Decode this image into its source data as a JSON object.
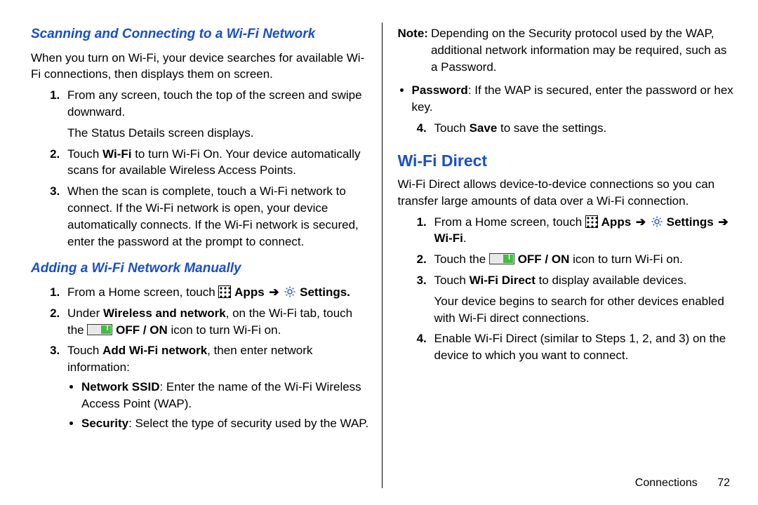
{
  "left": {
    "heading1": "Scanning and Connecting to a Wi-Fi Network",
    "intro": "When you turn on Wi-Fi, your device searches for available Wi-Fi connections, then displays them on screen.",
    "step1": "From any screen, touch the top of the screen and swipe downward.",
    "step1b": "The Status Details screen displays.",
    "step2a": "Touch ",
    "step2b": "Wi-Fi",
    "step2c": " to turn Wi-Fi On. Your device automatically scans for available Wireless Access Points.",
    "step3": "When the scan is complete, touch a Wi-Fi network to connect. If the Wi-Fi network is open, your device automatically connects. If the Wi-Fi network is secured, enter the password at the prompt to connect.",
    "heading2": "Adding a Wi-Fi Network Manually",
    "m1a": "From a Home screen, touch ",
    "m1_apps": "Apps",
    "m1_arrow": "➔",
    "m1_settings": "Settings.",
    "m2a": "Under ",
    "m2b": "Wireless and network",
    "m2c": ", on the Wi-Fi tab, touch the ",
    "m2_offon": " OFF / ON",
    "m2d": " icon to turn Wi-Fi on.",
    "m3a": "Touch ",
    "m3b": "Add Wi-Fi network",
    "m3c": ", then enter network information:",
    "b1a": "Network SSID",
    "b1b": ": Enter the name of the Wi-Fi Wireless Access Point (WAP).",
    "b2a": "Security",
    "b2b": ": Select the type of security used by the WAP."
  },
  "right": {
    "note_label": "Note:",
    "note_body": "Depending on the Security protocol used by the WAP, additional network information may be required, such as a Password.",
    "pw_a": "Password",
    "pw_b": ": If the WAP is secured, enter the password or hex key.",
    "save_a": "Touch ",
    "save_b": "Save",
    "save_c": " to save the settings.",
    "title": "Wi-Fi Direct",
    "intro": "Wi-Fi Direct allows device-to-device connections so you can transfer large amounts of data over a Wi-Fi connection.",
    "d1a": "From a Home screen, touch ",
    "d1_apps": "Apps",
    "d1_arrow1": "➔",
    "d1_settings": "Settings",
    "d1_arrow2": "➔",
    "d1_wifi": "Wi-Fi",
    "d1_dot": ".",
    "d2a": "Touch the ",
    "d2_offon": " OFF / ON",
    "d2b": " icon to turn Wi-Fi on.",
    "d3a": "Touch ",
    "d3b": "Wi-Fi Direct",
    "d3c": " to display available devices.",
    "d3d": "Your device begins to search for other devices enabled with Wi-Fi direct connections.",
    "d4": "Enable Wi-Fi Direct (similar to Steps 1, 2, and 3) on the device to which you want to connect."
  },
  "footer": {
    "section": "Connections",
    "page": "72"
  }
}
